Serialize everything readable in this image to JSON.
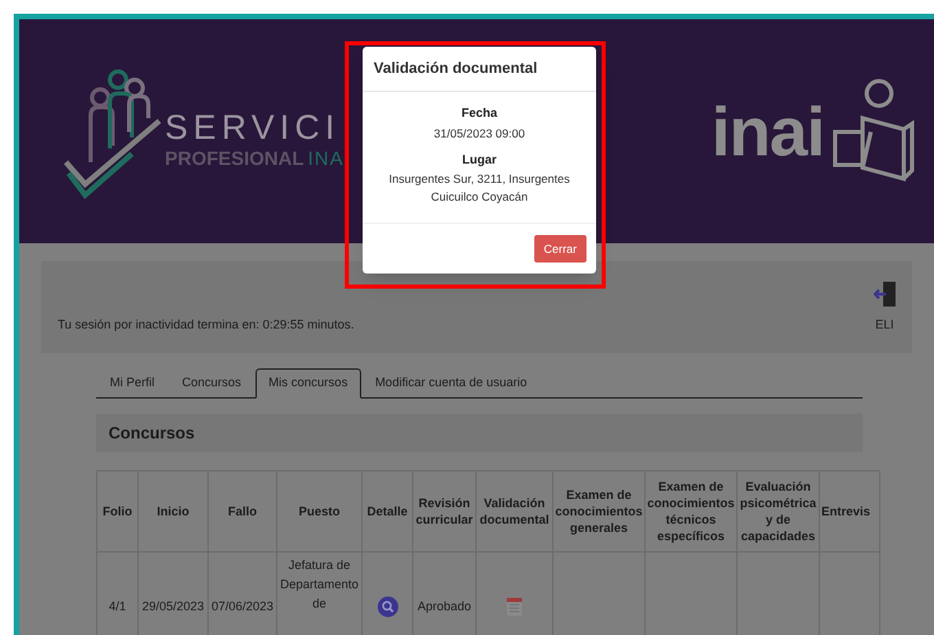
{
  "banner": {
    "brand_word": "SERVICI",
    "brand_sub": "PROFESIONAL",
    "brand_sub_accent": "INA",
    "logo_text": "inai"
  },
  "modal": {
    "title": "Validación documental",
    "fields": [
      {
        "label": "Fecha",
        "value": "31/05/2023 09:00"
      },
      {
        "label": "Lugar",
        "value": "Insurgentes Sur, 3211, Insurgentes Cuicuilco Coyacán"
      }
    ],
    "close_button": "Cerrar"
  },
  "session": {
    "message": "Tu sesión por inactividad termina en: 0:29:55 minutos.",
    "user": "ELI"
  },
  "tabs": [
    {
      "label": "Mi Perfil",
      "selected": false
    },
    {
      "label": "Concursos",
      "selected": false
    },
    {
      "label": "Mis concursos",
      "selected": true
    },
    {
      "label": "Modificar cuenta de usuario",
      "selected": false
    }
  ],
  "panel_title": "Concursos",
  "table": {
    "columns": [
      "Folio",
      "Inicio",
      "Fallo",
      "Puesto",
      "Detalle",
      "Revisión curricular",
      "Validación documental",
      "Examen de conocimientos generales",
      "Examen de conocimientos técnicos específicos",
      "Evaluación psicométrica y de capacidades",
      "Entrevis"
    ],
    "rows": [
      {
        "cells": [
          {
            "kind": "text",
            "text": "4/1"
          },
          {
            "kind": "text",
            "text": "29/05/2023"
          },
          {
            "kind": "text",
            "text": "07/06/2023"
          },
          {
            "kind": "top",
            "text": "Jefatura de Departamento de"
          },
          {
            "kind": "search"
          },
          {
            "kind": "text",
            "text": "Aprobado"
          },
          {
            "kind": "calendar"
          },
          {
            "kind": "empty"
          },
          {
            "kind": "empty"
          },
          {
            "kind": "empty"
          },
          {
            "kind": "empty"
          }
        ]
      }
    ]
  }
}
